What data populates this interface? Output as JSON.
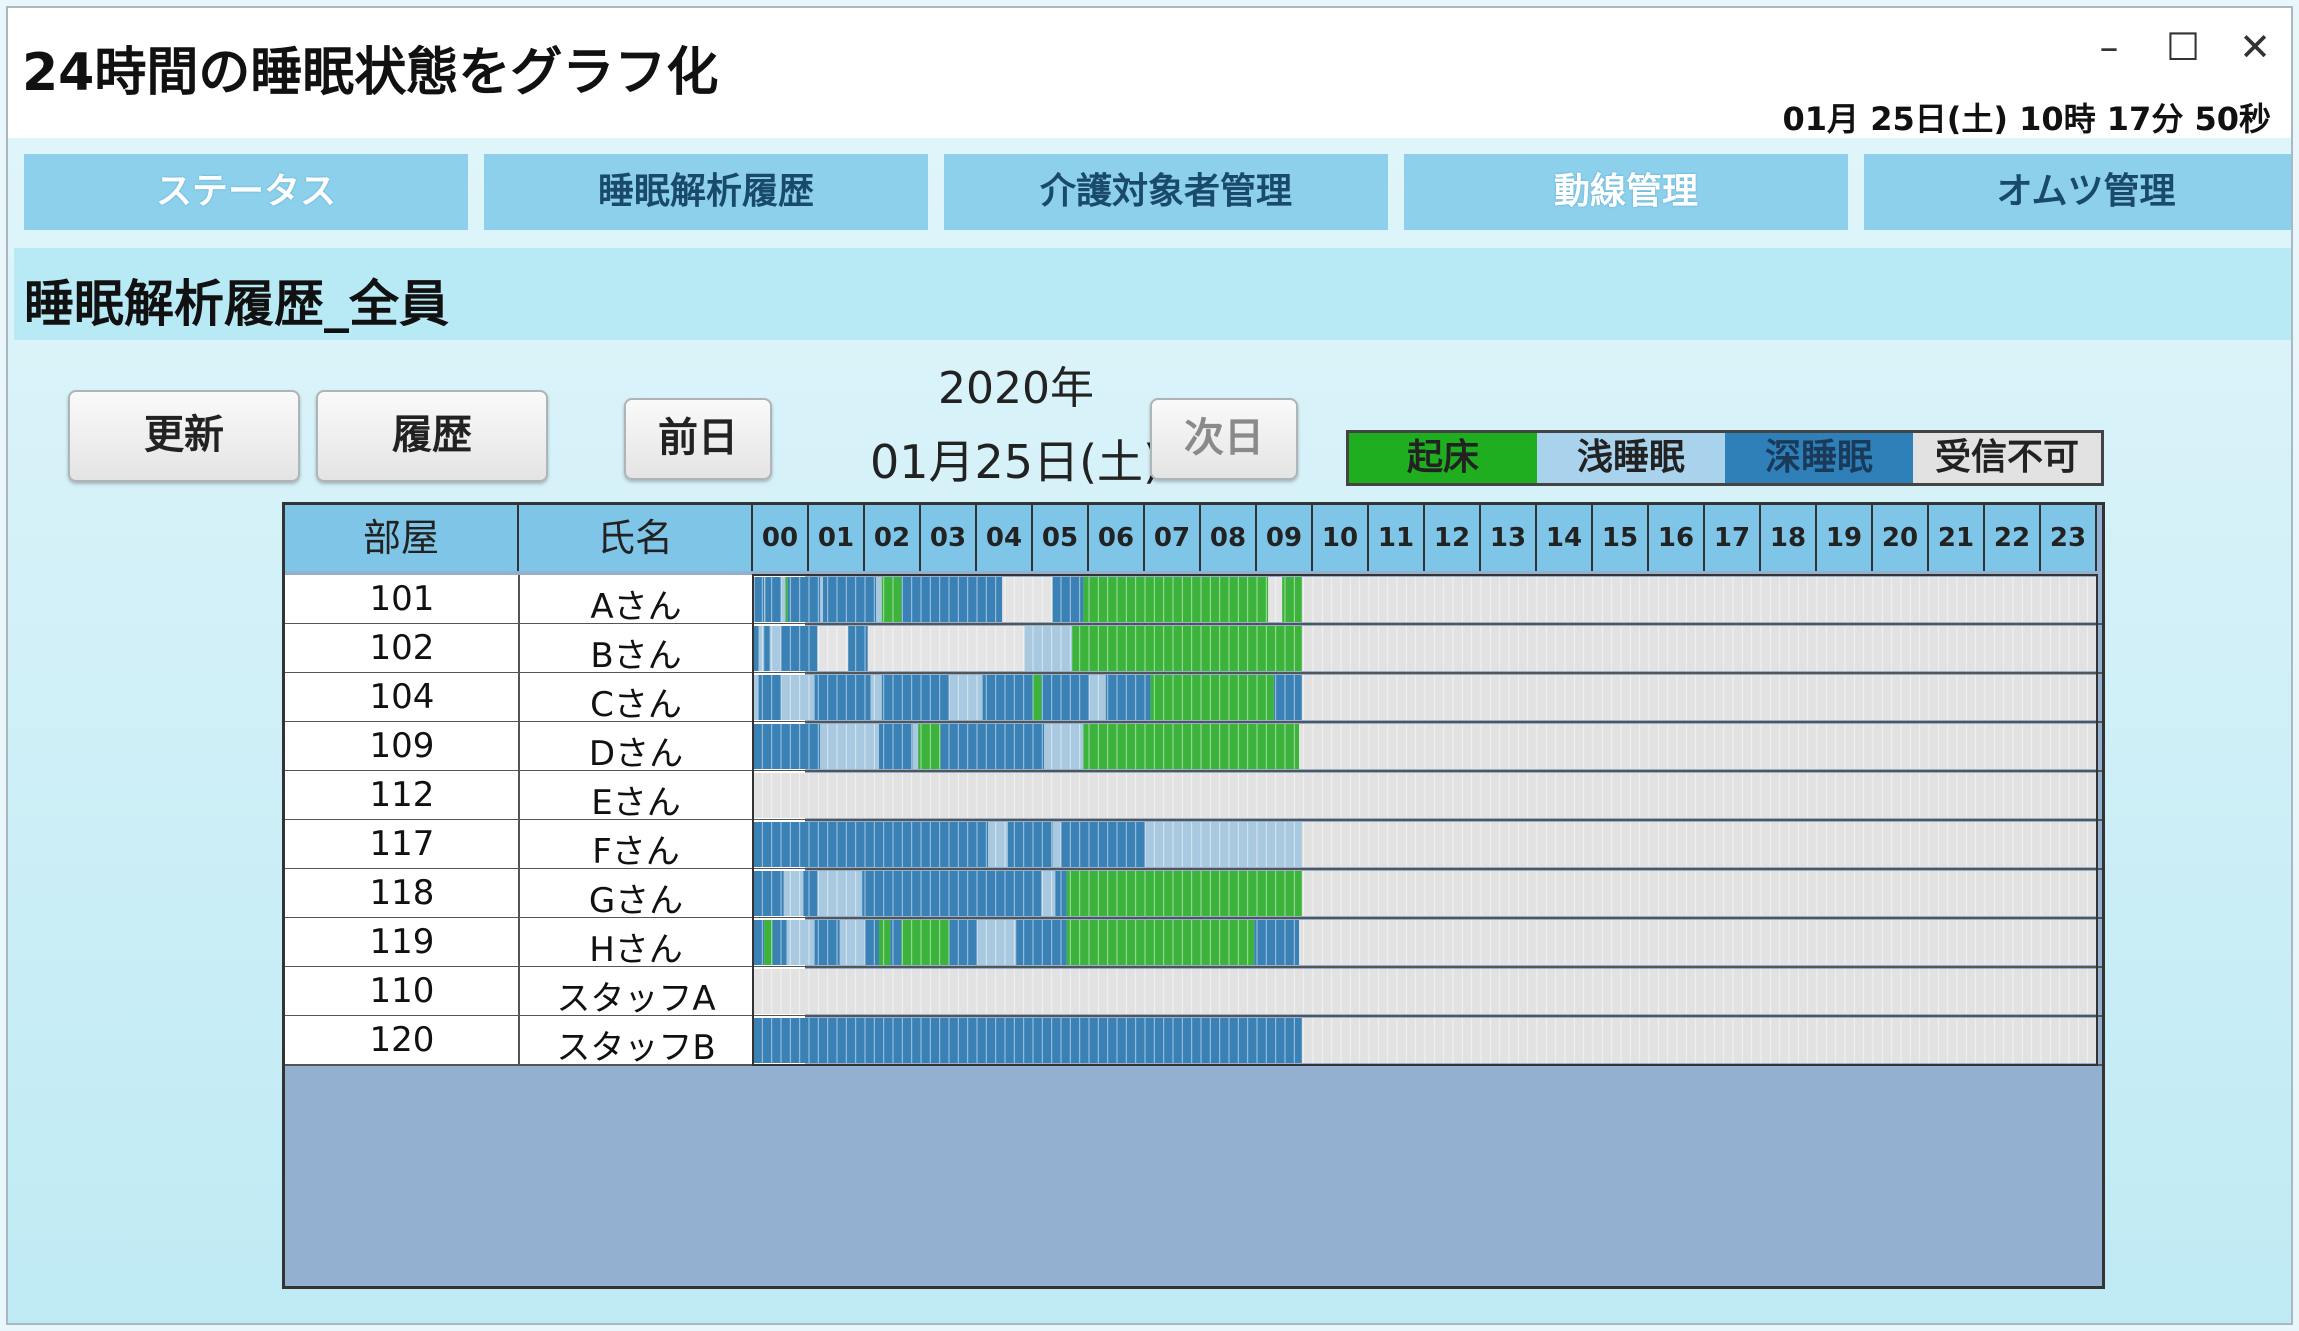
{
  "window": {
    "title": "24時間の睡眠状態をグラフ化",
    "minimize_icon": "minimize-icon",
    "maximize_icon": "maximize-icon",
    "close_icon": "close-icon",
    "clock": "01月 25日(土) 10時 17分 50秒"
  },
  "tabs": [
    {
      "label": "ステータス"
    },
    {
      "label": "睡眠解析履歴"
    },
    {
      "label": "介護対象者管理"
    },
    {
      "label": "動線管理"
    },
    {
      "label": "オムツ管理"
    }
  ],
  "section": {
    "title": "睡眠解析履歴_全員"
  },
  "toolbar": {
    "refresh_label": "更新",
    "history_label": "履歴",
    "prev_label": "前日",
    "next_label": "次日",
    "year": "2020年",
    "day": "01月25日(土)"
  },
  "legend": [
    {
      "label": "起床",
      "color": "#1fae1f"
    },
    {
      "label": "浅睡眠",
      "color": "#a9c9e0"
    },
    {
      "label": "深睡眠",
      "color": "#2f7fb8"
    },
    {
      "label": "受信不可",
      "color": "#e2e2e2"
    }
  ],
  "table": {
    "col_room": "部屋",
    "col_name": "氏名",
    "hours": [
      "00",
      "01",
      "02",
      "03",
      "04",
      "05",
      "06",
      "07",
      "08",
      "09",
      "10",
      "11",
      "12",
      "13",
      "14",
      "15",
      "16",
      "17",
      "18",
      "19",
      "20",
      "21",
      "22",
      "23"
    ],
    "rows": [
      {
        "room": "101",
        "name": "Aさん",
        "segments": [
          [
            "L",
            0.0,
            0.03
          ],
          [
            "D",
            0.03,
            0.2
          ],
          [
            "L",
            0.2,
            0.22
          ],
          [
            "D",
            0.22,
            0.5
          ],
          [
            "L",
            0.5,
            0.58
          ],
          [
            "W",
            0.58,
            0.62
          ],
          [
            "D",
            0.62,
            1.2
          ],
          [
            "L",
            1.2,
            1.25
          ],
          [
            "D",
            1.25,
            2.2
          ],
          [
            "L",
            2.2,
            2.3
          ],
          [
            "W",
            2.3,
            2.65
          ],
          [
            "D",
            2.65,
            4.45
          ],
          [
            "U",
            4.45,
            5.35
          ],
          [
            "D",
            5.35,
            5.9
          ],
          [
            "W",
            5.9,
            9.2
          ],
          [
            "U",
            9.2,
            9.45
          ],
          [
            "W",
            9.45,
            9.8
          ]
        ]
      },
      {
        "room": "102",
        "name": "Bさん",
        "segments": [
          [
            "D",
            0.0,
            0.1
          ],
          [
            "L",
            0.1,
            0.2
          ],
          [
            "D",
            0.2,
            0.3
          ],
          [
            "L",
            0.3,
            0.5
          ],
          [
            "D",
            0.5,
            1.15
          ],
          [
            "U",
            1.15,
            1.7
          ],
          [
            "D",
            1.7,
            2.05
          ],
          [
            "U",
            2.05,
            4.85
          ],
          [
            "L",
            4.85,
            5.7
          ],
          [
            "W",
            5.7,
            9.8
          ]
        ]
      },
      {
        "room": "104",
        "name": "Cさん",
        "segments": [
          [
            "L",
            0.0,
            0.1
          ],
          [
            "D",
            0.1,
            0.5
          ],
          [
            "L",
            0.5,
            1.1
          ],
          [
            "D",
            1.1,
            2.1
          ],
          [
            "L",
            2.1,
            2.3
          ],
          [
            "D",
            2.3,
            3.5
          ],
          [
            "L",
            3.5,
            4.1
          ],
          [
            "D",
            4.1,
            5.0
          ],
          [
            "W",
            5.0,
            5.15
          ],
          [
            "D",
            5.15,
            6.0
          ],
          [
            "L",
            6.0,
            6.3
          ],
          [
            "D",
            6.3,
            7.1
          ],
          [
            "W",
            7.1,
            9.3
          ],
          [
            "D",
            9.3,
            9.8
          ]
        ]
      },
      {
        "room": "109",
        "name": "Dさん",
        "segments": [
          [
            "D",
            0.0,
            1.2
          ],
          [
            "L",
            1.2,
            2.25
          ],
          [
            "D",
            2.25,
            2.85
          ],
          [
            "L",
            2.85,
            2.95
          ],
          [
            "W",
            2.95,
            3.35
          ],
          [
            "D",
            3.35,
            5.2
          ],
          [
            "L",
            5.2,
            5.9
          ],
          [
            "W",
            5.9,
            9.75
          ]
        ]
      },
      {
        "room": "112",
        "name": "Eさん",
        "segments": []
      },
      {
        "room": "117",
        "name": "Fさん",
        "segments": [
          [
            "D",
            0.0,
            4.2
          ],
          [
            "L",
            4.2,
            4.55
          ],
          [
            "D",
            4.55,
            5.35
          ],
          [
            "L",
            5.35,
            5.5
          ],
          [
            "D",
            5.5,
            7.0
          ],
          [
            "L",
            7.0,
            9.8
          ]
        ]
      },
      {
        "room": "118",
        "name": "Gさん",
        "segments": [
          [
            "D",
            0.0,
            0.55
          ],
          [
            "L",
            0.55,
            0.9
          ],
          [
            "D",
            0.9,
            1.15
          ],
          [
            "L",
            1.15,
            1.95
          ],
          [
            "D",
            1.95,
            5.15
          ],
          [
            "L",
            5.15,
            5.4
          ],
          [
            "D",
            5.4,
            5.6
          ],
          [
            "W",
            5.6,
            9.8
          ]
        ]
      },
      {
        "room": "119",
        "name": "Hさん",
        "segments": [
          [
            "D",
            0.0,
            0.2
          ],
          [
            "W",
            0.2,
            0.35
          ],
          [
            "D",
            0.35,
            0.6
          ],
          [
            "L",
            0.6,
            1.1
          ],
          [
            "D",
            1.1,
            1.55
          ],
          [
            "L",
            1.55,
            2.0
          ],
          [
            "D",
            2.0,
            2.25
          ],
          [
            "W",
            2.25,
            2.45
          ],
          [
            "D",
            2.45,
            2.65
          ],
          [
            "W",
            2.65,
            3.5
          ],
          [
            "D",
            3.5,
            4.0
          ],
          [
            "L",
            4.0,
            4.7
          ],
          [
            "D",
            4.7,
            5.6
          ],
          [
            "W",
            5.6,
            8.95
          ],
          [
            "D",
            8.95,
            9.75
          ]
        ]
      },
      {
        "room": "110",
        "name": "スタッフA",
        "segments": []
      },
      {
        "room": "120",
        "name": "スタッフB",
        "segments": [
          [
            "D",
            0.0,
            9.8
          ]
        ]
      }
    ]
  }
}
